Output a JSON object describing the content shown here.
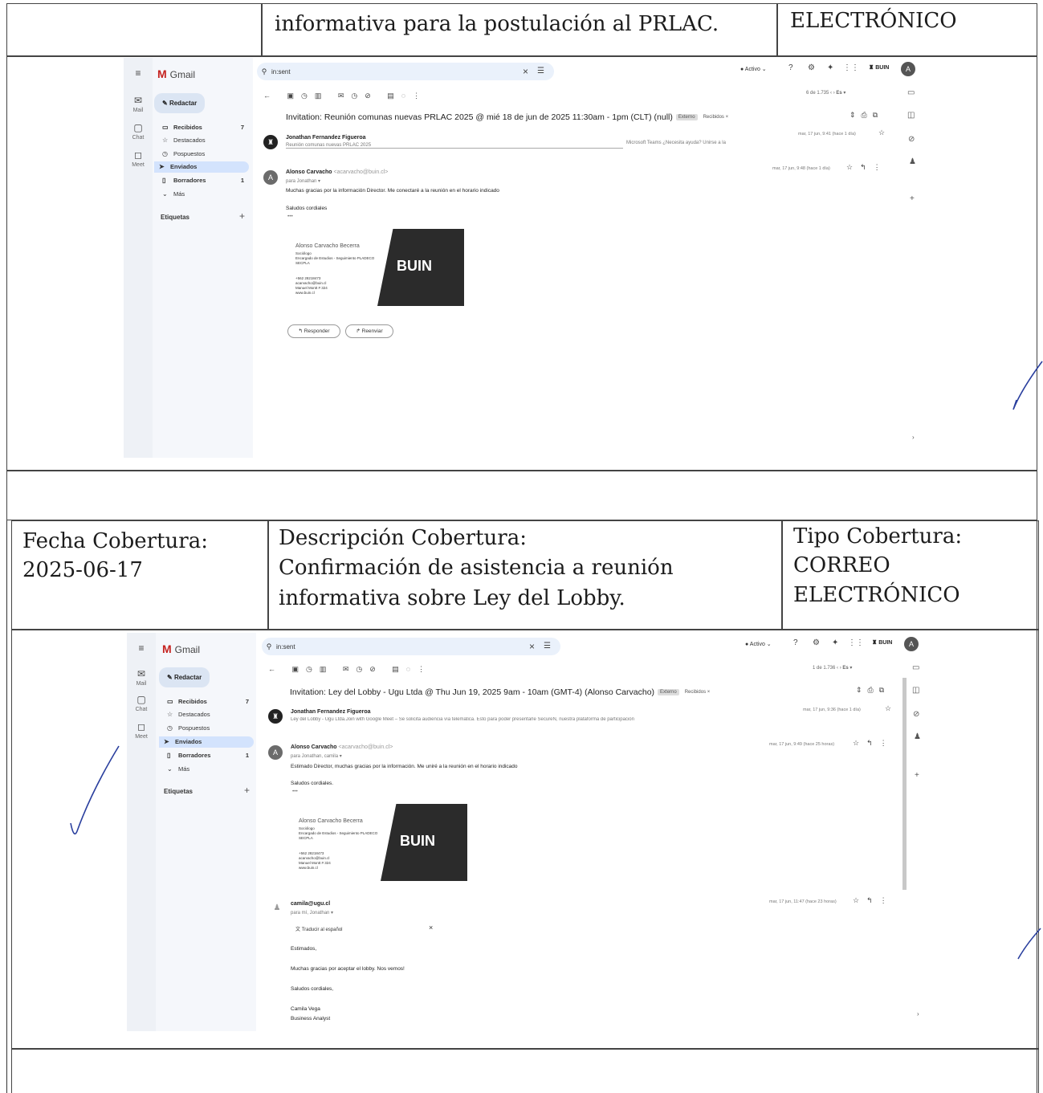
{
  "row0": {
    "desc_tail": "informativa para la postulación al PRLAC.",
    "tipo_tail": "ELECTRÓNICO"
  },
  "row1": {
    "fecha_label": "Fecha Cobertura:",
    "fecha_value": "2025-06-17",
    "desc_label": "Descripción Cobertura:",
    "desc_line1": "Confirmación de asistencia a reunión",
    "desc_line2": "informativa sobre Ley del Lobby.",
    "tipo_label": "Tipo Cobertura:",
    "tipo_line1": "CORREO",
    "tipo_line2": "ELECTRÓNICO"
  },
  "shot1": {
    "app_name": "Gmail",
    "search_value": "in:sent",
    "status": "Activo",
    "brand_chip": "BUIN",
    "user_initial": "A",
    "compose": "Redactar",
    "rail": [
      "Mail",
      "Chat",
      "Meet"
    ],
    "nav": [
      {
        "label": "Recibidos",
        "count": "7",
        "icon": "inbox-icon",
        "glyph": "▭"
      },
      {
        "label": "Destacados",
        "count": "",
        "icon": "star-icon",
        "glyph": "☆"
      },
      {
        "label": "Pospuestos",
        "count": "",
        "icon": "clock-icon",
        "glyph": "◷"
      },
      {
        "label": "Enviados",
        "count": "",
        "icon": "send-icon",
        "glyph": "➤"
      },
      {
        "label": "Borradores",
        "count": "1",
        "icon": "draft-icon",
        "glyph": "▯"
      },
      {
        "label": "Más",
        "count": "",
        "icon": "chevron-down-icon",
        "glyph": "⌄"
      }
    ],
    "labels": "Etiquetas",
    "pager": "6 de 1.735",
    "lang": "Es",
    "subject": "Invitation: Reunión comunas nuevas PRLAC 2025 @ mié 18 de jun de 2025 11:30am - 1pm (CLT) (null)",
    "badge1": "Externo",
    "badge2": "Recibidos ×",
    "msg1": {
      "sender": "Jonathan Fernandez Figueroa",
      "preview": "Reunión comunas nuevas PRLAC 2025",
      "preview_right": "Microsoft Teams ¿Necesita ayuda? Unirse a la",
      "meta": "mar, 17 jun, 9:41 (hace 1 día)"
    },
    "msg2": {
      "sender": "Alonso Carvacho",
      "sender_email": "<acarvacho@buin.cl>",
      "to": "para Jonathan ▾",
      "meta": "mar, 17 jun, 9:48 (hace 1 día)",
      "body": "Muchas gracias por la información Director. Me conectaré a la reunión en el horario indicado",
      "closing": "Saludos cordiales",
      "ellipsis": "•••"
    },
    "signature": {
      "name": "Alonso Carvacho Becerra",
      "lines": [
        "Sociólogo",
        "Encargado de Estudios - Seguimiento PLADECO",
        "SECPLA",
        "",
        "+562 28218473",
        "acarvacho@buin.cl",
        "Manuel Montt # 324",
        "www.buin.cl"
      ],
      "logo": "BUIN"
    },
    "reply": "Responder",
    "forward": "Reenviar"
  },
  "shot2": {
    "app_name": "Gmail",
    "search_value": "in:sent",
    "status": "Activo",
    "brand_chip": "BUIN",
    "user_initial": "A",
    "compose": "Redactar",
    "rail": [
      "Mail",
      "Chat",
      "Meet"
    ],
    "nav": [
      {
        "label": "Recibidos",
        "count": "7",
        "icon": "inbox-icon",
        "glyph": "▭"
      },
      {
        "label": "Destacados",
        "count": "",
        "icon": "star-icon",
        "glyph": "☆"
      },
      {
        "label": "Pospuestos",
        "count": "",
        "icon": "clock-icon",
        "glyph": "◷"
      },
      {
        "label": "Enviados",
        "count": "",
        "icon": "send-icon",
        "glyph": "➤"
      },
      {
        "label": "Borradores",
        "count": "1",
        "icon": "draft-icon",
        "glyph": "▯"
      },
      {
        "label": "Más",
        "count": "",
        "icon": "chevron-down-icon",
        "glyph": "⌄"
      }
    ],
    "labels": "Etiquetas",
    "pager": "1 de 1.736",
    "lang": "Es",
    "subject": "Invitation: Ley del Lobby - Ugu Ltda @ Thu Jun 19, 2025 9am - 10am (GMT-4) (Alonso Carvacho)",
    "badge1": "Externo",
    "badge2": "Recibidos ×",
    "msg1": {
      "sender": "Jonathan Fernandez Figueroa",
      "preview": "Ley del Lobby - Ugu Ltda.Join with Google Meet – Se solicita audiencia vía telemática. Esto para poder presentarle SecureN, nuestra plataforma de participación",
      "meta": "mar, 17 jun, 9:36 (hace 1 día)"
    },
    "msg2": {
      "sender": "Alonso Carvacho",
      "sender_email": "<acarvacho@buin.cl>",
      "to": "para Jonathan, camila ▾",
      "meta": "mar, 17 jun, 9:49 (hace 25 horas)",
      "body": "Estimado Director, muchas gracias por la información. Me uniré a la reunión en el horario indicado",
      "closing": "Saludos cordiales.",
      "ellipsis": "•••"
    },
    "signature": {
      "name": "Alonso Carvacho Becerra",
      "lines": [
        "Sociólogo",
        "Encargado de Estudios - Seguimiento PLADECO",
        "SECPLA",
        "",
        "+562 28218473",
        "acarvacho@buin.cl",
        "Manuel Montt # 324",
        "www.buin.cl"
      ],
      "logo": "BUIN"
    },
    "msg3": {
      "sender": "camila@ugu.cl",
      "to": "para mí, Jonathan ▾",
      "meta": "mar, 17 jun, 11:47 (hace 23 horas)",
      "translate": "Traducir al español",
      "greeting": "Estimados,",
      "body": "Muchas gracias por aceptar el lobby. Nos vemos!",
      "closing": "Saludos cordiales,",
      "sig_name": "Camila Vega",
      "sig_title": "Business Analyst"
    }
  }
}
